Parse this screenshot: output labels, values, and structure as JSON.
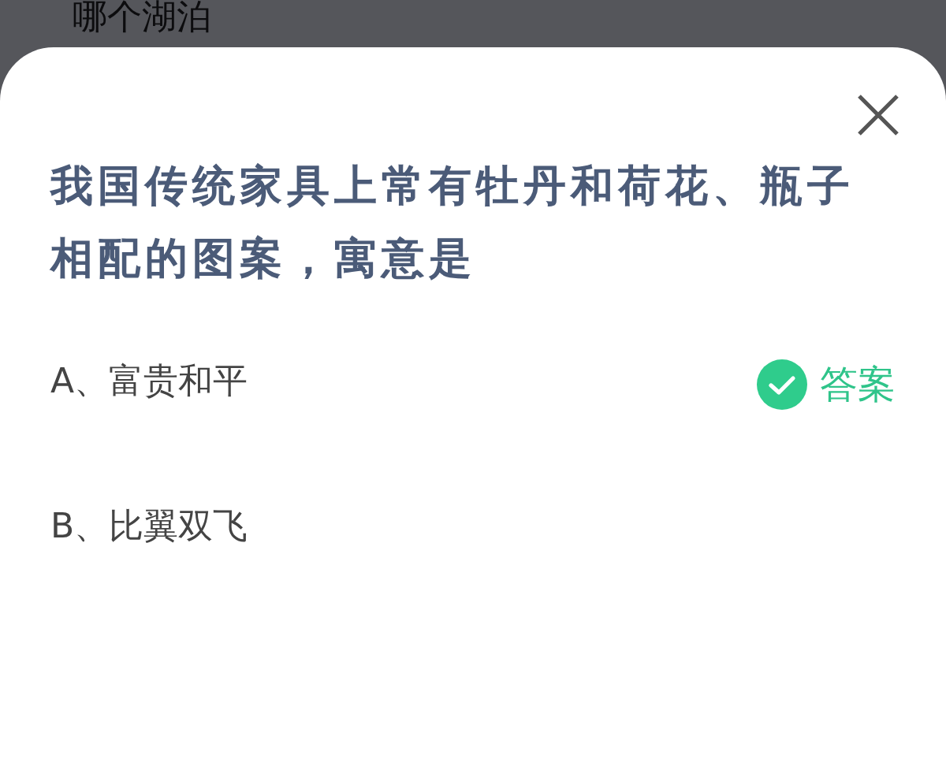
{
  "background_text": "哪个湖泊",
  "question": "我国传统家具上常有牡丹和荷花、瓶子相配的图案，寓意是",
  "options": [
    {
      "label": "A、富贵和平",
      "correct": true,
      "badge": "答案"
    },
    {
      "label": "B、比翼双飞",
      "correct": false
    }
  ]
}
